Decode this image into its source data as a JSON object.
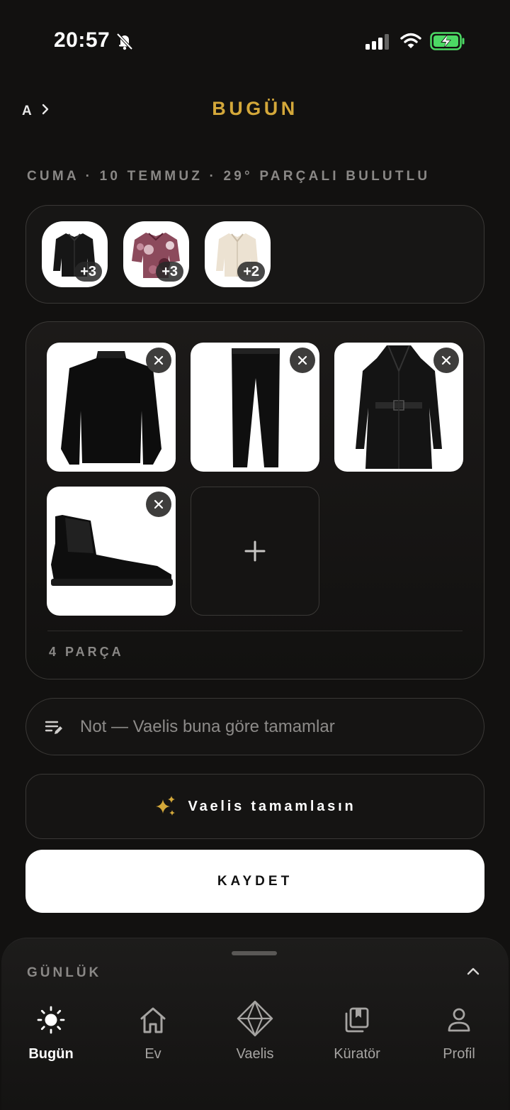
{
  "status_bar": {
    "time": "20:57",
    "icons": [
      "bell-slash-icon",
      "cellular-signal-icon",
      "wifi-icon",
      "battery-charging-icon"
    ],
    "battery_color": "#4cd964"
  },
  "header": {
    "user_initial": "A",
    "title": "BUGÜN",
    "accent_color": "#d4a83a"
  },
  "context": {
    "date_weather": "CUMA · 10 TEMMUZ · 29° PARÇALI BULUTLU"
  },
  "suggestions": [
    {
      "item": "black shirt",
      "badge": "+3"
    },
    {
      "item": "floral print shirt",
      "badge": "+3"
    },
    {
      "item": "cream shirt",
      "badge": "+2"
    }
  ],
  "outfit": {
    "items": [
      {
        "item": "black sweater"
      },
      {
        "item": "black trousers"
      },
      {
        "item": "black leather trench coat"
      },
      {
        "item": "black chelsea boots"
      }
    ],
    "add_icon": "plus-icon",
    "count_label": "4 PARÇA"
  },
  "note": {
    "placeholder": "Not — Vaelis buna göre tamamlar",
    "value": ""
  },
  "ai_button": {
    "label": "Vaelis tamamlasın",
    "icon": "sparkles-icon"
  },
  "save_button": {
    "label": "KAYDET"
  },
  "sheet": {
    "title": "GÜNLÜK",
    "toggle_icon": "chevron-up-icon"
  },
  "tabbar": {
    "active": "Bugün",
    "tabs": [
      {
        "label": "Bugün",
        "icon": "sun-icon"
      },
      {
        "label": "Ev",
        "icon": "home-icon"
      },
      {
        "label": "Vaelis",
        "icon": "diamond-logo-icon"
      },
      {
        "label": "Küratör",
        "icon": "bookmark-stack-icon"
      },
      {
        "label": "Profil",
        "icon": "person-icon"
      }
    ]
  }
}
